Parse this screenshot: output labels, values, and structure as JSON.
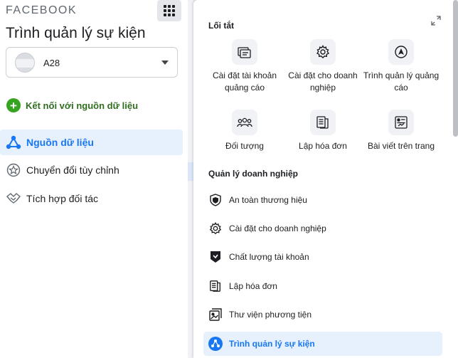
{
  "brand": "FACEBOOK",
  "page_title": "Trình quản lý sự kiện",
  "account": {
    "name": "A28"
  },
  "connect_label": "Kết nối với nguồn dữ liệu",
  "nav": [
    {
      "label": "Nguồn dữ liệu",
      "icon": "data-sources-icon",
      "active": true
    },
    {
      "label": "Chuyển đổi tùy chỉnh",
      "icon": "star-badge-icon"
    },
    {
      "label": "Tích hợp đối tác",
      "icon": "handshake-icon"
    }
  ],
  "menu": {
    "shortcuts_title": "Lối tắt",
    "shortcuts": [
      {
        "label": "Cài đặt tài khoản quảng cáo",
        "icon": "ad-account-settings-icon"
      },
      {
        "label": "Cài đặt cho doanh nghiệp",
        "icon": "gear-icon"
      },
      {
        "label": "Trình quản lý quảng cáo",
        "icon": "ads-manager-icon"
      },
      {
        "label": "Đối tượng",
        "icon": "audience-icon"
      },
      {
        "label": "Lập hóa đơn",
        "icon": "billing-icon"
      },
      {
        "label": "Bài viết trên trang",
        "icon": "page-posts-icon"
      }
    ],
    "management_title": "Quản lý doanh nghiệp",
    "management": [
      {
        "label": "An toàn thương hiệu",
        "icon": "shield-icon"
      },
      {
        "label": "Cài đặt cho doanh nghiệp",
        "icon": "gear-icon"
      },
      {
        "label": "Chất lượng tài khoản",
        "icon": "account-quality-icon"
      },
      {
        "label": "Lập hóa đơn",
        "icon": "billing-icon"
      },
      {
        "label": "Thư viện phương tiện",
        "icon": "media-library-icon"
      },
      {
        "label": "Trình quản lý sự kiện",
        "icon": "events-manager-icon",
        "active": true
      }
    ]
  },
  "colors": {
    "accent": "#1877f2",
    "green": "#36a420",
    "active_bg": "#e7f0fd"
  }
}
